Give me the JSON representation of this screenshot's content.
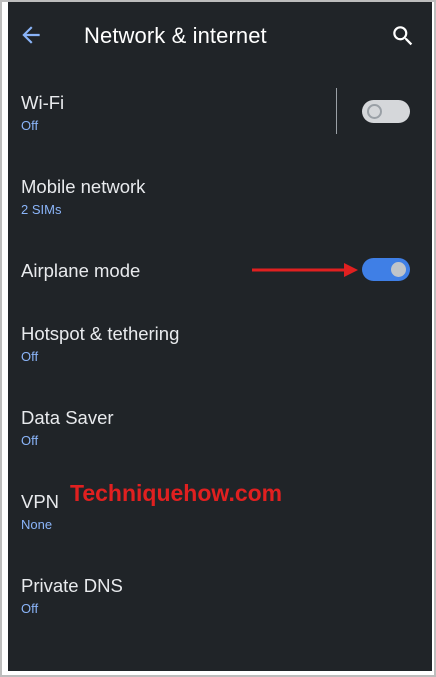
{
  "header": {
    "title": "Network & internet",
    "back_icon": "arrow-left-icon",
    "search_icon": "search-icon"
  },
  "settings": {
    "wifi": {
      "title": "Wi-Fi",
      "subtitle": "Off",
      "toggle_on": false
    },
    "mobile_network": {
      "title": "Mobile network",
      "subtitle": "2 SIMs"
    },
    "airplane_mode": {
      "title": "Airplane mode",
      "toggle_on": true
    },
    "hotspot": {
      "title": "Hotspot & tethering",
      "subtitle": "Off"
    },
    "data_saver": {
      "title": "Data Saver",
      "subtitle": "Off"
    },
    "vpn": {
      "title": "VPN",
      "subtitle": "None"
    },
    "private_dns": {
      "title": "Private DNS",
      "subtitle": "Off"
    }
  },
  "annotation": {
    "watermark": "Techniquehow.com",
    "arrow_color": "#e02020"
  },
  "colors": {
    "background": "#202428",
    "accent": "#8ab4f8",
    "switch_on": "#3f7fe6"
  }
}
